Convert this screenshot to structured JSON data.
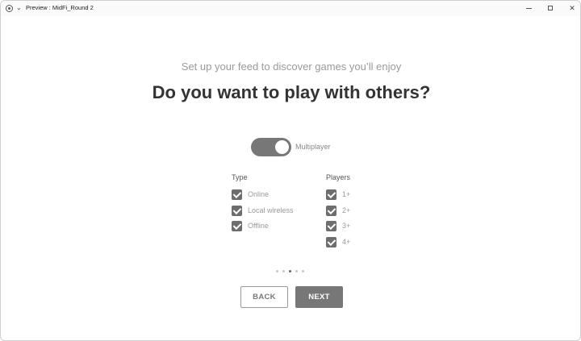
{
  "window": {
    "title": "Preview : MidFi_Round 2",
    "controls": {
      "minimize": "minimize-icon",
      "maximize": "maximize-icon",
      "close": "✕"
    }
  },
  "onboarding": {
    "subtitle": "Set up your feed to discover games you’ll enjoy",
    "question": "Do you want to play with others?",
    "toggle": {
      "label": "Multiplayer",
      "on": true
    },
    "type": {
      "heading": "Type",
      "options": [
        {
          "label": "Online",
          "checked": true
        },
        {
          "label": "Local wireless",
          "checked": true
        },
        {
          "label": "Offline",
          "checked": true
        }
      ]
    },
    "players": {
      "heading": "Players",
      "options": [
        {
          "label": "1+",
          "checked": true
        },
        {
          "label": "2+",
          "checked": true
        },
        {
          "label": "3+",
          "checked": true
        },
        {
          "label": "4+",
          "checked": true
        }
      ]
    },
    "pagination": {
      "total": 5,
      "current": 3
    },
    "buttons": {
      "back": "BACK",
      "next": "NEXT"
    }
  },
  "colors": {
    "accent": "#777777",
    "heading": "#333333",
    "muted_text": "#9a9a9a"
  }
}
